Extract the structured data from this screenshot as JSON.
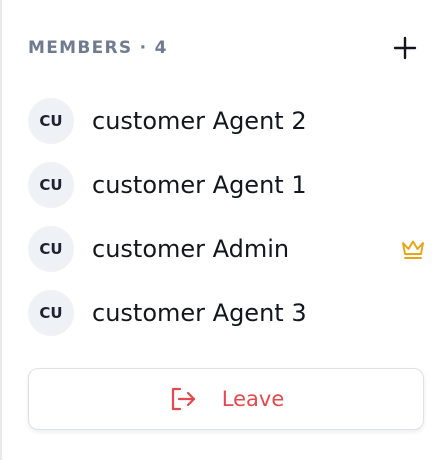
{
  "members_panel": {
    "title": "MEMBERS · 4",
    "add_button_icon": "plus-icon",
    "members": [
      {
        "initials": "CU",
        "name": "customer Agent 2",
        "is_admin": false
      },
      {
        "initials": "CU",
        "name": "customer Agent 1",
        "is_admin": false
      },
      {
        "initials": "CU",
        "name": "customer Admin",
        "is_admin": true,
        "badge_icon": "crown-icon"
      },
      {
        "initials": "CU",
        "name": "customer Agent 3",
        "is_admin": false
      }
    ],
    "leave_button": {
      "label": "Leave",
      "icon": "leave-icon"
    }
  },
  "colors": {
    "title": "#6f7c90",
    "avatar_bg": "#eef1f6",
    "crown": "#e5a514",
    "leave": "#e5484d"
  }
}
